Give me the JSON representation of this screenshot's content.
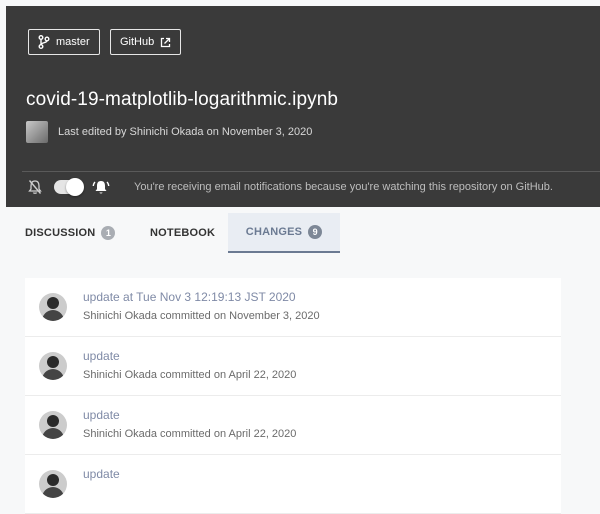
{
  "branch": {
    "label": "master",
    "icon": "git-branch-icon"
  },
  "github": {
    "label": "GitHub",
    "icon": "external-link-icon"
  },
  "notebook_title": "covid-19-matplotlib-logarithmic.ipynb",
  "last_edited": "Last edited by Shinichi Okada on November 3, 2020",
  "notifications": {
    "text": "You're receiving email notifications because you're watching this repository on GitHub.",
    "muted_icon": "bell-off-icon",
    "active_icon": "bell-ring-icon",
    "toggle_on": true
  },
  "tabs": [
    {
      "label": "DISCUSSION",
      "count": "1"
    },
    {
      "label": "NOTEBOOK"
    },
    {
      "label": "CHANGES",
      "count": "9",
      "active": true
    }
  ],
  "commits": [
    {
      "message": "update at Tue Nov 3 12:19:13 JST 2020",
      "meta": "Shinichi Okada committed on November 3, 2020"
    },
    {
      "message": "update",
      "meta": "Shinichi Okada committed on April 22, 2020"
    },
    {
      "message": "update",
      "meta": "Shinichi Okada committed on April 22, 2020"
    },
    {
      "message": "update",
      "meta": ""
    }
  ],
  "colors": {
    "header_bg": "#3a3a3a",
    "accent": "#6b7a92",
    "link": "#7f8aa6"
  }
}
